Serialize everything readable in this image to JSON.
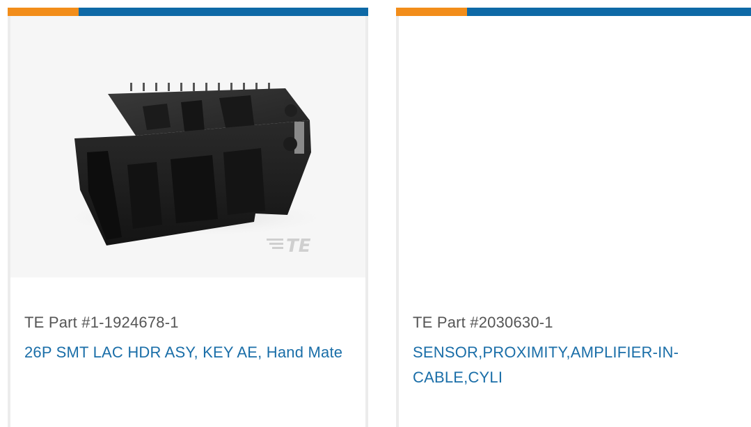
{
  "colors": {
    "accent_orange": "#f28d1a",
    "accent_blue": "#0e69a6",
    "link_blue": "#1a6ea8",
    "label_gray": "#555555"
  },
  "cards": [
    {
      "part_number": "TE Part #1-1924678-1",
      "title": "26P SMT LAC HDR ASY, KEY AE, Hand Mate",
      "image": "connector-product-photo",
      "watermark": "TE"
    },
    {
      "part_number": "TE Part #2030630-1",
      "title": "SENSOR,PROXIMITY,AMPLIFIER-IN-CABLE,CYLI",
      "image": "empty"
    }
  ]
}
